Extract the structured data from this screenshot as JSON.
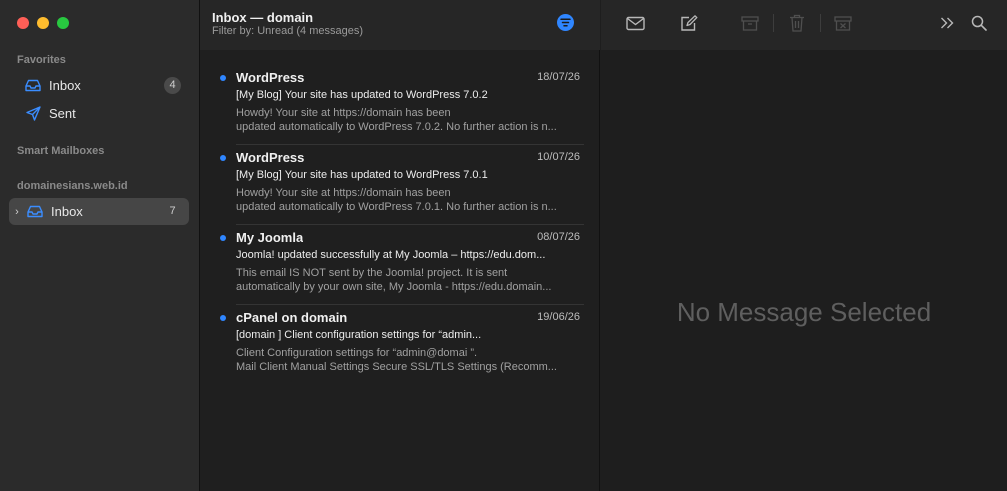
{
  "window": {
    "controls": [
      "close",
      "minimize",
      "zoom"
    ]
  },
  "sidebar": {
    "favorites_label": "Favorites",
    "favorites": [
      {
        "label": "Inbox",
        "count": "4",
        "icon": "inbox-tray-icon"
      },
      {
        "label": "Sent",
        "icon": "paper-plane-icon"
      }
    ],
    "smart_mailboxes_label": "Smart Mailboxes",
    "account_label": "domainesians.web.id",
    "account_items": [
      {
        "label": "Inbox",
        "count": "7",
        "icon": "inbox-tray-icon",
        "selected": true
      }
    ]
  },
  "list": {
    "title": "Inbox — domain",
    "filter_text": "Filter by: Unread (4 messages)",
    "messages": [
      {
        "from": "WordPress",
        "date": "18/07/26",
        "subject": "[My Blog] Your site has updated to WordPress 7.0.2",
        "preview_line1": "Howdy! Your site at https://domain                         has been",
        "preview_line2": "updated automatically to WordPress 7.0.2. No further action is n..."
      },
      {
        "from": "WordPress",
        "date": "10/07/26",
        "subject": "[My Blog] Your site has updated to WordPress 7.0.1",
        "preview_line1": "Howdy! Your site at https://domain                         has been",
        "preview_line2": "updated automatically to WordPress 7.0.1. No further action is n..."
      },
      {
        "from": "My Joomla",
        "date": "08/07/26",
        "subject": "Joomla! updated successfully at My Joomla – https://edu.dom...",
        "preview_line1": "This email IS NOT sent by the Joomla! project. It is sent",
        "preview_line2": "automatically by your own site, My Joomla - https://edu.domain..."
      },
      {
        "from": "cPanel on domain",
        "date": "19/06/26",
        "subject": "[domain                       ] Client configuration settings for “admin...",
        "preview_line1": "Client Configuration settings for “admin@domai                  ”.",
        "preview_line2": "Mail Client Manual Settings Secure SSL/TLS Settings (Recomm..."
      }
    ]
  },
  "detail": {
    "empty_text": "No Message Selected",
    "toolbar_icons": [
      "envelope-icon",
      "compose-icon",
      "archive-icon",
      "trash-icon",
      "junk-icon",
      "more-chevrons-icon",
      "search-icon"
    ]
  },
  "colors": {
    "accent": "#2f86ff",
    "sidebar_bg": "#2b2b2b",
    "list_bg": "#1f1f1f"
  }
}
